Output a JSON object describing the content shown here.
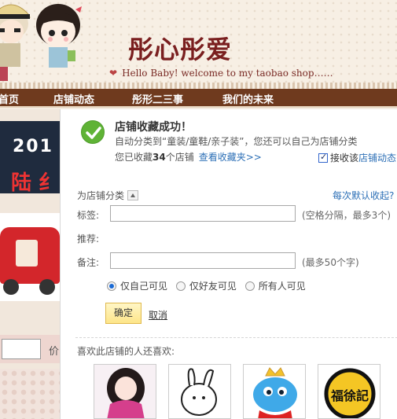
{
  "header": {
    "shop_title": "彤心彤爱",
    "welcome": "Hello Baby! welcome to my taobao shop……"
  },
  "nav": {
    "items": [
      "首页",
      "店铺动态",
      "彤形二三事",
      "我们的未来"
    ]
  },
  "background": {
    "promo_year": "201",
    "promo_text": "陆 纟",
    "side_text": "价"
  },
  "dialog": {
    "success_title": "店铺收藏成功！",
    "auto_category": "自动分类到“童装/童鞋/亲子装”，您还可以自己为店铺分类",
    "collected_prefix": "您已收藏",
    "collected_count": "34",
    "collected_suffix": "个店铺",
    "view_favorites": "查看收藏夹>>",
    "receive_updates_prefix": "接收该",
    "receive_updates_link": "店铺动态",
    "receive_updates_checked": true,
    "category_label": "为店铺分类",
    "default_collapse": "每次默认收起?",
    "tags_label": "标签:",
    "tags_value": "",
    "tags_hint": "(空格分隔，最多3个)",
    "recommend_label": "推荐:",
    "note_label": "备注:",
    "note_value": "",
    "note_hint": "(最多50个字)",
    "visibility_options": [
      "仅自己可见",
      "仅好友可见",
      "所有人可见"
    ],
    "visibility_selected": "仅自己可见",
    "ok_button": "确定",
    "cancel_link": "取消",
    "also_like": "喜欢此店铺的人还喜欢:",
    "thumb_badge_text": "福徐記"
  },
  "colors": {
    "nav_bg": "#6f3a1e",
    "title_color": "#7a1f1f",
    "link_blue": "#2c6fb6",
    "success_green": "#5fb336",
    "ok_button_bg": "#fde589"
  }
}
